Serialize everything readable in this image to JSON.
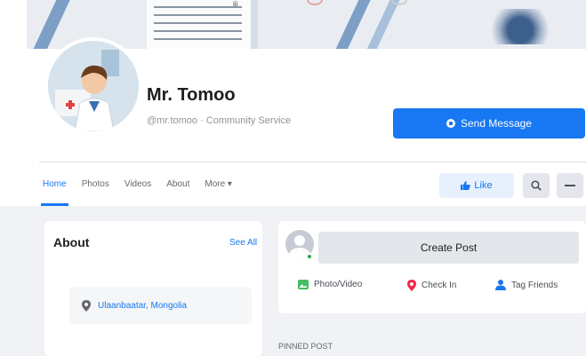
{
  "profile": {
    "name": "Mr. Tomoo",
    "handle_line": "@mr.tomoo · Community Service"
  },
  "actions": {
    "send_message": "Send Message",
    "like": "Like"
  },
  "nav": {
    "tabs": [
      "Home",
      "Photos",
      "Videos",
      "About",
      "More ▾"
    ]
  },
  "about": {
    "title": "About",
    "see_all": "See All",
    "location": "Ulaanbaatar, Mongolia"
  },
  "composer": {
    "create_post": "Create Post",
    "photo_video": "Photo/Video",
    "check_in": "Check In",
    "tag_friends": "Tag Friends"
  },
  "pinned_label": "PINNED POST",
  "top_fragment": "iii",
  "colors": {
    "accent": "#1877f2",
    "background": "#f0f2f5"
  }
}
